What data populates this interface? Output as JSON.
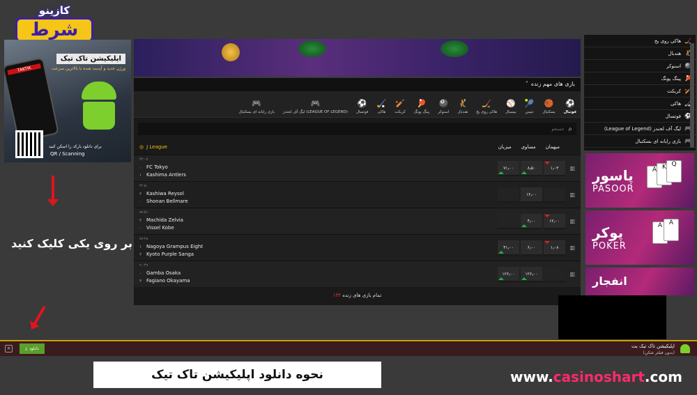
{
  "logo": {
    "top": "کازینو",
    "big": "شرط"
  },
  "left_ad": {
    "title": "اپلیکیشن تاک تیک",
    "subtitle": "ورژن جدید و آپدیت شده با بالاترین سرعت",
    "phone_brand": "TAKTIK",
    "qr_note": "برای دانلود بارکد را اسکن کنید",
    "qr_text": "QR / Scanning"
  },
  "instruction": "بر روی یکی کلیک کنید",
  "main": {
    "important_header": "بازی های مهم زنده",
    "important_chevron": "˅",
    "sports_tabs": [
      {
        "label": "فوتبال",
        "icon": "⚽",
        "active": true
      },
      {
        "label": "بسکتبال",
        "icon": "🏀",
        "active": false
      },
      {
        "label": "تنیس",
        "icon": "🎾",
        "active": false
      },
      {
        "label": "بیسبال",
        "icon": "⚾",
        "active": false
      },
      {
        "label": "هاکی روی یخ",
        "icon": "🏒",
        "active": false
      },
      {
        "label": "هندبال",
        "icon": "🤾",
        "active": false
      },
      {
        "label": "اسنوکر",
        "icon": "🎱",
        "active": false
      },
      {
        "label": "پینگ پونگ",
        "icon": "🏓",
        "active": false
      },
      {
        "label": "کریکت",
        "icon": "🏏",
        "active": false
      },
      {
        "label": "هاکی",
        "icon": "🏑",
        "active": false
      },
      {
        "label": "فوتسال",
        "icon": "⚽",
        "active": false
      },
      {
        "label": "لیگ آف لجندز (LEAGUE OF LEGEND)",
        "icon": "🎮",
        "active": false
      },
      {
        "label": "بازی رایانه ای بسکتبال",
        "icon": "🎮",
        "active": false
      }
    ],
    "search_placeholder": "جستجو",
    "league": "J League",
    "columns": [
      "میهمان",
      "مساوی",
      "میزبان"
    ],
    "matches": [
      {
        "time": "۴۲:۰۷",
        "home": "FC Tokyo",
        "away": "Kashima Antlers",
        "home_score": "۰",
        "away_score": "۱",
        "odds": [
          "۱٫۰۳",
          "۸٫۵۰",
          "۷۱٫۰۰"
        ]
      },
      {
        "time": "۴۲:۵۰",
        "home": "Kashiwa Reysol",
        "away": "Shonan Bellmare",
        "home_score": "۲",
        "away_score": "۰",
        "odds": [
          "",
          "۱۲٫۰۰",
          ""
        ]
      },
      {
        "time": "۸۷:۵۱",
        "home": "Machida Zelvia",
        "away": "Vissel Kobe",
        "home_score": "۲",
        "away_score": "۰",
        "odds": [
          "۱۲٫۰۰",
          "۴٫۰۰",
          ""
        ]
      },
      {
        "time": "۸۷:۲۸",
        "home": "Nagoya Grampus Eight",
        "away": "Kyoto Purple Sanga",
        "home_score": "۱",
        "away_score": "۲",
        "odds": [
          "۱٫۰۸",
          "۶٫۰۰",
          "۴۱٫۰۰"
        ]
      },
      {
        "time": "۹۰:۴۹",
        "home": "Gamba Osaka",
        "away": "Fagiano Okayama",
        "home_score": "۰",
        "away_score": "۳",
        "odds": [
          "",
          "۱۲۶٫۰۰",
          "۱۲۶٫۰۰"
        ]
      }
    ],
    "all_live_prefix": "تمام بازی های زنده",
    "all_live_count": "۱۳۴"
  },
  "right_list": [
    {
      "label": "هاکی روی یخ",
      "icon": "🏒"
    },
    {
      "label": "هندبال",
      "icon": "🤾"
    },
    {
      "label": "اسنوکر",
      "icon": "🎱"
    },
    {
      "label": "پینگ پونگ",
      "icon": "🏓"
    },
    {
      "label": "کریکت",
      "icon": "🏏"
    },
    {
      "label": "هاکی",
      "icon": "🏑"
    },
    {
      "label": "فوتسال",
      "icon": "⚽"
    },
    {
      "label": "لیگ آف لجندز (League of Legend)",
      "icon": "🎮"
    },
    {
      "label": "بازی رایانه ای بسکتبال",
      "icon": "🎮"
    }
  ],
  "promos": [
    {
      "fa": "پاسور",
      "en": "PASOOR"
    },
    {
      "fa": "پوکر",
      "en": "POKER"
    },
    {
      "fa": "انفجار",
      "en": ""
    }
  ],
  "download_bar": {
    "close": "×",
    "button": "دانلود",
    "title": "اپلیکیشن تاک تیک بت",
    "subtitle": "(بدون فیلتر شکن)"
  },
  "footer": {
    "how_to": "نحوه دانلود اپلیکیشن تاک تیک",
    "url_prefix": "www.",
    "url_accent": "casinoshart",
    "url_suffix": ".com"
  },
  "colors": {
    "accent": "#f2c21b",
    "download_green": "#5b9e2b",
    "live_red": "#e8313a",
    "url_pink": "#ff2a6d"
  }
}
